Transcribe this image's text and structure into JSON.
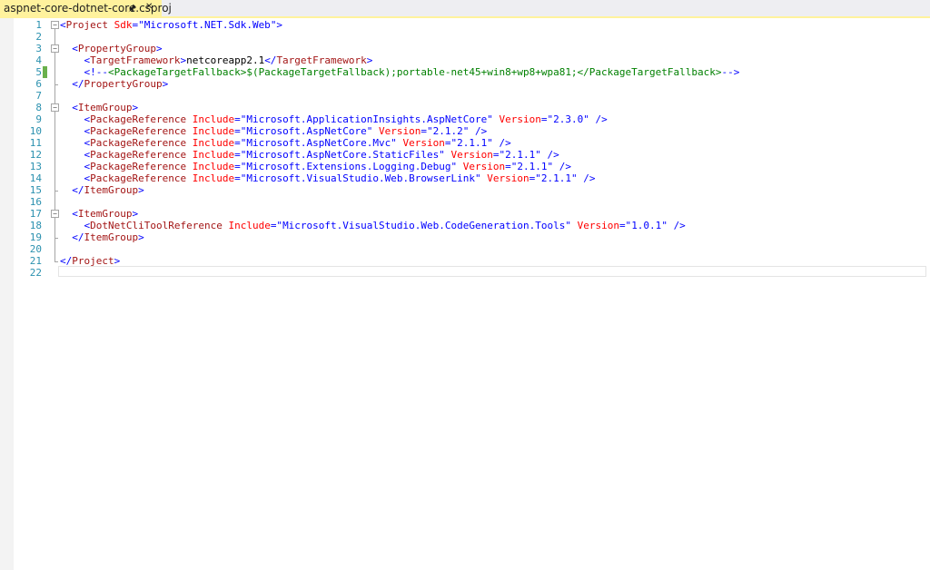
{
  "tab": {
    "title": "aspnet-core-dotnet-core.csproj",
    "pin_icon": "pin-icon",
    "close_icon": "close-icon",
    "accent_color": "#fff29d"
  },
  "editor": {
    "colors": {
      "line_number": "#2b91af",
      "xml_delimiter": "#0000ff",
      "xml_tag": "#a31515",
      "xml_attribute": "#ff0000",
      "xml_value": "#0000ff",
      "comment": "#008000",
      "change_saved": "#6ab04c"
    },
    "lines": [
      {
        "n": "1",
        "tokens": [
          {
            "c": "t-del",
            "t": "<"
          },
          {
            "c": "t-tag",
            "t": "Project"
          },
          {
            "c": "t-text",
            "t": " "
          },
          {
            "c": "t-attr",
            "t": "Sdk"
          },
          {
            "c": "t-del",
            "t": "=\""
          },
          {
            "c": "t-val",
            "t": "Microsoft.NET.Sdk.Web"
          },
          {
            "c": "t-del",
            "t": "\">"
          }
        ]
      },
      {
        "n": "2",
        "tokens": []
      },
      {
        "n": "3",
        "tokens": [
          {
            "c": "t-text",
            "t": "  "
          },
          {
            "c": "t-del",
            "t": "<"
          },
          {
            "c": "t-tag",
            "t": "PropertyGroup"
          },
          {
            "c": "t-del",
            "t": ">"
          }
        ]
      },
      {
        "n": "4",
        "tokens": [
          {
            "c": "t-text",
            "t": "    "
          },
          {
            "c": "t-del",
            "t": "<"
          },
          {
            "c": "t-tag",
            "t": "TargetFramework"
          },
          {
            "c": "t-del",
            "t": ">"
          },
          {
            "c": "t-text",
            "t": "netcoreapp2.1"
          },
          {
            "c": "t-del",
            "t": "</"
          },
          {
            "c": "t-tag",
            "t": "TargetFramework"
          },
          {
            "c": "t-del",
            "t": ">"
          }
        ]
      },
      {
        "n": "5",
        "tokens": [
          {
            "c": "t-text",
            "t": "    "
          },
          {
            "c": "t-del",
            "t": "<!--"
          },
          {
            "c": "t-com",
            "t": "<PackageTargetFallback>$(PackageTargetFallback);portable-net45+win8+wp8+wpa81;</PackageTargetFallback>"
          },
          {
            "c": "t-del",
            "t": "-->"
          }
        ],
        "changed": true
      },
      {
        "n": "6",
        "tokens": [
          {
            "c": "t-text",
            "t": "  "
          },
          {
            "c": "t-del",
            "t": "</"
          },
          {
            "c": "t-tag",
            "t": "PropertyGroup"
          },
          {
            "c": "t-del",
            "t": ">"
          }
        ]
      },
      {
        "n": "7",
        "tokens": []
      },
      {
        "n": "8",
        "tokens": [
          {
            "c": "t-text",
            "t": "  "
          },
          {
            "c": "t-del",
            "t": "<"
          },
          {
            "c": "t-tag",
            "t": "ItemGroup"
          },
          {
            "c": "t-del",
            "t": ">"
          }
        ]
      },
      {
        "n": "9",
        "tokens": [
          {
            "c": "t-text",
            "t": "    "
          },
          {
            "c": "t-del",
            "t": "<"
          },
          {
            "c": "t-tag",
            "t": "PackageReference"
          },
          {
            "c": "t-text",
            "t": " "
          },
          {
            "c": "t-attr",
            "t": "Include"
          },
          {
            "c": "t-del",
            "t": "=\""
          },
          {
            "c": "t-val",
            "t": "Microsoft.ApplicationInsights.AspNetCore"
          },
          {
            "c": "t-del",
            "t": "\""
          },
          {
            "c": "t-text",
            "t": " "
          },
          {
            "c": "t-attr",
            "t": "Version"
          },
          {
            "c": "t-del",
            "t": "=\""
          },
          {
            "c": "t-val",
            "t": "2.3.0"
          },
          {
            "c": "t-del",
            "t": "\""
          },
          {
            "c": "t-text",
            "t": " "
          },
          {
            "c": "t-del",
            "t": "/>"
          }
        ]
      },
      {
        "n": "10",
        "tokens": [
          {
            "c": "t-text",
            "t": "    "
          },
          {
            "c": "t-del",
            "t": "<"
          },
          {
            "c": "t-tag",
            "t": "PackageReference"
          },
          {
            "c": "t-text",
            "t": " "
          },
          {
            "c": "t-attr",
            "t": "Include"
          },
          {
            "c": "t-del",
            "t": "=\""
          },
          {
            "c": "t-val",
            "t": "Microsoft.AspNetCore"
          },
          {
            "c": "t-del",
            "t": "\""
          },
          {
            "c": "t-text",
            "t": " "
          },
          {
            "c": "t-attr",
            "t": "Version"
          },
          {
            "c": "t-del",
            "t": "=\""
          },
          {
            "c": "t-val",
            "t": "2.1.2"
          },
          {
            "c": "t-del",
            "t": "\""
          },
          {
            "c": "t-text",
            "t": " "
          },
          {
            "c": "t-del",
            "t": "/>"
          }
        ]
      },
      {
        "n": "11",
        "tokens": [
          {
            "c": "t-text",
            "t": "    "
          },
          {
            "c": "t-del",
            "t": "<"
          },
          {
            "c": "t-tag",
            "t": "PackageReference"
          },
          {
            "c": "t-text",
            "t": " "
          },
          {
            "c": "t-attr",
            "t": "Include"
          },
          {
            "c": "t-del",
            "t": "=\""
          },
          {
            "c": "t-val",
            "t": "Microsoft.AspNetCore.Mvc"
          },
          {
            "c": "t-del",
            "t": "\""
          },
          {
            "c": "t-text",
            "t": " "
          },
          {
            "c": "t-attr",
            "t": "Version"
          },
          {
            "c": "t-del",
            "t": "=\""
          },
          {
            "c": "t-val",
            "t": "2.1.1"
          },
          {
            "c": "t-del",
            "t": "\""
          },
          {
            "c": "t-text",
            "t": " "
          },
          {
            "c": "t-del",
            "t": "/>"
          }
        ]
      },
      {
        "n": "12",
        "tokens": [
          {
            "c": "t-text",
            "t": "    "
          },
          {
            "c": "t-del",
            "t": "<"
          },
          {
            "c": "t-tag",
            "t": "PackageReference"
          },
          {
            "c": "t-text",
            "t": " "
          },
          {
            "c": "t-attr",
            "t": "Include"
          },
          {
            "c": "t-del",
            "t": "=\""
          },
          {
            "c": "t-val",
            "t": "Microsoft.AspNetCore.StaticFiles"
          },
          {
            "c": "t-del",
            "t": "\""
          },
          {
            "c": "t-text",
            "t": " "
          },
          {
            "c": "t-attr",
            "t": "Version"
          },
          {
            "c": "t-del",
            "t": "=\""
          },
          {
            "c": "t-val",
            "t": "2.1.1"
          },
          {
            "c": "t-del",
            "t": "\""
          },
          {
            "c": "t-text",
            "t": " "
          },
          {
            "c": "t-del",
            "t": "/>"
          }
        ]
      },
      {
        "n": "13",
        "tokens": [
          {
            "c": "t-text",
            "t": "    "
          },
          {
            "c": "t-del",
            "t": "<"
          },
          {
            "c": "t-tag",
            "t": "PackageReference"
          },
          {
            "c": "t-text",
            "t": " "
          },
          {
            "c": "t-attr",
            "t": "Include"
          },
          {
            "c": "t-del",
            "t": "=\""
          },
          {
            "c": "t-val",
            "t": "Microsoft.Extensions.Logging.Debug"
          },
          {
            "c": "t-del",
            "t": "\""
          },
          {
            "c": "t-text",
            "t": " "
          },
          {
            "c": "t-attr",
            "t": "Version"
          },
          {
            "c": "t-del",
            "t": "=\""
          },
          {
            "c": "t-val",
            "t": "2.1.1"
          },
          {
            "c": "t-del",
            "t": "\""
          },
          {
            "c": "t-text",
            "t": " "
          },
          {
            "c": "t-del",
            "t": "/>"
          }
        ]
      },
      {
        "n": "14",
        "tokens": [
          {
            "c": "t-text",
            "t": "    "
          },
          {
            "c": "t-del",
            "t": "<"
          },
          {
            "c": "t-tag",
            "t": "PackageReference"
          },
          {
            "c": "t-text",
            "t": " "
          },
          {
            "c": "t-attr",
            "t": "Include"
          },
          {
            "c": "t-del",
            "t": "=\""
          },
          {
            "c": "t-val",
            "t": "Microsoft.VisualStudio.Web.BrowserLink"
          },
          {
            "c": "t-del",
            "t": "\""
          },
          {
            "c": "t-text",
            "t": " "
          },
          {
            "c": "t-attr",
            "t": "Version"
          },
          {
            "c": "t-del",
            "t": "=\""
          },
          {
            "c": "t-val",
            "t": "2.1.1"
          },
          {
            "c": "t-del",
            "t": "\""
          },
          {
            "c": "t-text",
            "t": " "
          },
          {
            "c": "t-del",
            "t": "/>"
          }
        ]
      },
      {
        "n": "15",
        "tokens": [
          {
            "c": "t-text",
            "t": "  "
          },
          {
            "c": "t-del",
            "t": "</"
          },
          {
            "c": "t-tag",
            "t": "ItemGroup"
          },
          {
            "c": "t-del",
            "t": ">"
          }
        ]
      },
      {
        "n": "16",
        "tokens": []
      },
      {
        "n": "17",
        "tokens": [
          {
            "c": "t-text",
            "t": "  "
          },
          {
            "c": "t-del",
            "t": "<"
          },
          {
            "c": "t-tag",
            "t": "ItemGroup"
          },
          {
            "c": "t-del",
            "t": ">"
          }
        ]
      },
      {
        "n": "18",
        "tokens": [
          {
            "c": "t-text",
            "t": "    "
          },
          {
            "c": "t-del",
            "t": "<"
          },
          {
            "c": "t-tag",
            "t": "DotNetCliToolReference"
          },
          {
            "c": "t-text",
            "t": " "
          },
          {
            "c": "t-attr",
            "t": "Include"
          },
          {
            "c": "t-del",
            "t": "=\""
          },
          {
            "c": "t-val",
            "t": "Microsoft.VisualStudio.Web.CodeGeneration.Tools"
          },
          {
            "c": "t-del",
            "t": "\""
          },
          {
            "c": "t-text",
            "t": " "
          },
          {
            "c": "t-attr",
            "t": "Version"
          },
          {
            "c": "t-del",
            "t": "=\""
          },
          {
            "c": "t-val",
            "t": "1.0.1"
          },
          {
            "c": "t-del",
            "t": "\""
          },
          {
            "c": "t-text",
            "t": " "
          },
          {
            "c": "t-del",
            "t": "/>"
          }
        ]
      },
      {
        "n": "19",
        "tokens": [
          {
            "c": "t-text",
            "t": "  "
          },
          {
            "c": "t-del",
            "t": "</"
          },
          {
            "c": "t-tag",
            "t": "ItemGroup"
          },
          {
            "c": "t-del",
            "t": ">"
          }
        ]
      },
      {
        "n": "20",
        "tokens": []
      },
      {
        "n": "21",
        "tokens": [
          {
            "c": "t-del",
            "t": "</"
          },
          {
            "c": "t-tag",
            "t": "Project"
          },
          {
            "c": "t-del",
            "t": ">"
          }
        ]
      },
      {
        "n": "22",
        "tokens": []
      }
    ]
  }
}
